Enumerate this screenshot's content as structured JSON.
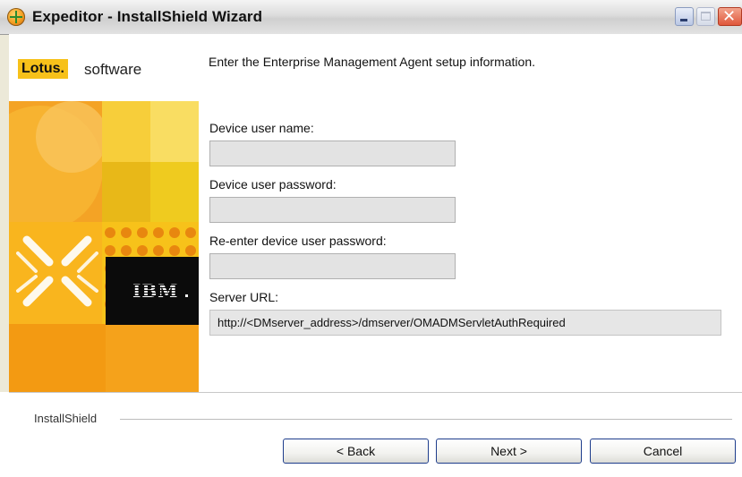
{
  "window": {
    "title": "Expeditor - InstallShield Wizard",
    "icon": "expeditor-app-icon",
    "controls": [
      "minimize-icon",
      "maximize-icon",
      "close-icon"
    ]
  },
  "branding": {
    "lotus_badge": "Lotus.",
    "lotus_software": "software",
    "ibm_logo": "IBM",
    "colors": {
      "lotus_yellow": "#f7c11a",
      "orange": "#f5a21b",
      "ibm_black": "#0b0b0b"
    }
  },
  "form": {
    "heading": "Enter the Enterprise Management Agent setup information.",
    "device_user_name_label": "Device user name:",
    "device_user_name_value": "",
    "device_user_password_label": "Device user password:",
    "device_user_password_value": "",
    "reenter_password_label": "Re-enter device user password:",
    "reenter_password_value": "",
    "server_url_label": "Server URL:",
    "server_url_value": "http://<DMserver_address>/dmserver/OMADMServletAuthRequired"
  },
  "footer": {
    "installshield_label": "InstallShield",
    "back_button": "< Back",
    "next_button": "Next >",
    "cancel_button": "Cancel"
  }
}
